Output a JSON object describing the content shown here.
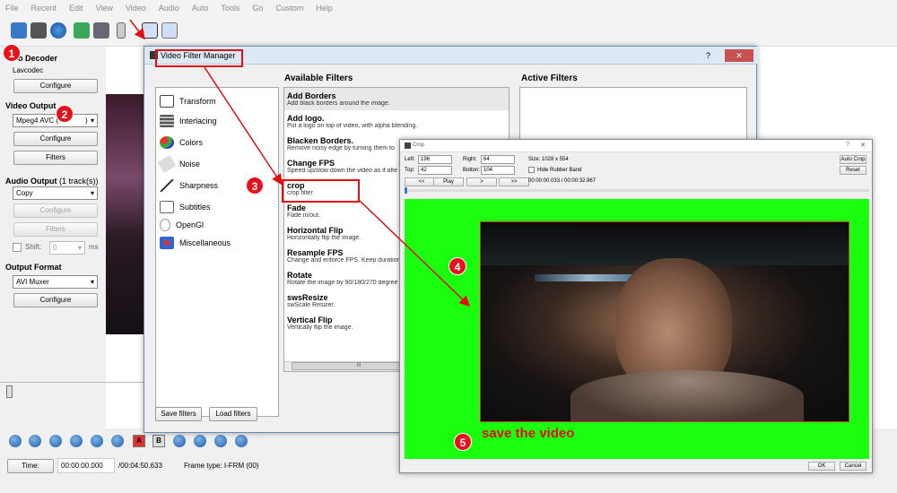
{
  "menu": [
    "File",
    "Recent",
    "Edit",
    "View",
    "Video",
    "Audio",
    "Auto",
    "Tools",
    "Go",
    "Custom",
    "Help"
  ],
  "left": {
    "video_decoder_title": "o Decoder",
    "decoder_value": "Lavcodec",
    "configure_label": "Configure",
    "video_output_title": "Video Output",
    "video_output_value": "Mpeg4 AVC (",
    "video_output_value_tail": ")",
    "filters_label": "Filters",
    "audio_output_title": "Audio Output",
    "audio_output_tracks": "(1 track(s))",
    "audio_output_value": "Copy",
    "shift_label": "Shift:",
    "shift_value": "0",
    "shift_unit": "ms",
    "output_format_title": "Output Format",
    "output_format_value": "AVI Muxer"
  },
  "vfm": {
    "title": "Video Filter Manager",
    "question": "?",
    "close": "✕",
    "available_title": "Available Filters",
    "active_title": "Active Filters",
    "categories": [
      "Transform",
      "Interlacing",
      "Colors",
      "Noise",
      "Sharpness",
      "Subtitles",
      "OpenGl",
      "Miscellaneous"
    ],
    "filters": [
      {
        "name": "Add Borders",
        "desc": "Add black borders around the image."
      },
      {
        "name": "Add logo.",
        "desc": "Put a logo on top of video, with alpha blending."
      },
      {
        "name": "Blacken Borders.",
        "desc": "Remove noisy edge by turning them to"
      },
      {
        "name": "Change FPS",
        "desc": "Speed up/slow down the video as if alte"
      },
      {
        "name": "crop",
        "desc": "crop filter"
      },
      {
        "name": "Fade",
        "desc": "Fade in/out."
      },
      {
        "name": "Horizontal Flip",
        "desc": "Horizontally flip the image."
      },
      {
        "name": "Resample FPS",
        "desc": "Change and enforce FPS. Keep duration"
      },
      {
        "name": "Rotate",
        "desc": "Rotate the image by 90/180/270 degree"
      },
      {
        "name": "swsResize",
        "desc": "swScale Resizer."
      },
      {
        "name": "Vertical Flip",
        "desc": "Vertically flip the image."
      }
    ],
    "save_filters": "Save filters",
    "load_filters": "Load filters",
    "scroll_grip": "III"
  },
  "crop": {
    "title": "Crop",
    "question": "?",
    "close": "✕",
    "left_label": "Left:",
    "left_value": "196",
    "right_label": "Right:",
    "right_value": "64",
    "top_label": "Top:",
    "top_value": "42",
    "bottom_label": "Botton:",
    "bottom_value": "104",
    "size_label": "Size: 1028 x 554",
    "hide_rubber": "Hide Rubber Band",
    "auto_crop": "Auto Crop",
    "reset": "Reset",
    "prev": "<<",
    "play": "Play",
    "step": ">",
    "next": ">>",
    "time": "00:00:00.033 / 00:00:32.967",
    "ok": "OK",
    "cancel": "Cancel",
    "annotation_5": "save the video"
  },
  "badges": [
    "1",
    "2",
    "3",
    "4",
    "5"
  ],
  "bottom": {
    "time_label": "Time:",
    "current_time": "00:00:00.000",
    "total_time": "/00:04:50.633",
    "frame_type": "Frame type:  I-FRM (00)",
    "a_label": "A",
    "b_label": "B"
  },
  "colors": {
    "badge": "#e8111b",
    "green": "#1aff10",
    "arrow": "#e01010"
  }
}
